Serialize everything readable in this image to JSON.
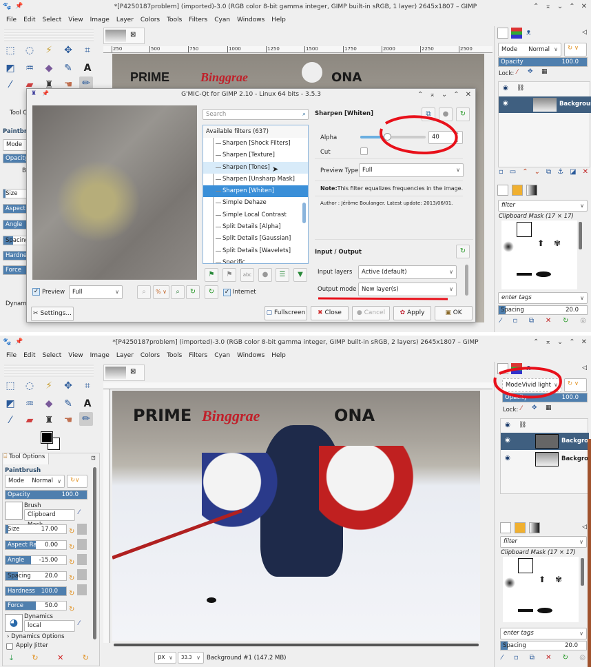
{
  "top": {
    "title": "*[P4250187problem] (imported)-3.0 (RGB color 8-bit gamma integer, GIMP built-in sRGB, 1 layer) 2645x1807 – GIMP",
    "window_controls": [
      "⌃",
      "⌅",
      "⌄",
      "⌃",
      "✕"
    ],
    "menu": [
      "File",
      "Edit",
      "Select",
      "View",
      "Image",
      "Layer",
      "Colors",
      "Tools",
      "Filters",
      "Cyan",
      "Windows",
      "Help"
    ],
    "ruler_ticks": [
      "250",
      "500",
      "750",
      "1000",
      "1250",
      "1500",
      "1750",
      "2000",
      "2250",
      "2500"
    ],
    "tool_options": {
      "tab": "Tool Op",
      "tool": "Paintbrush",
      "mode": "Mode",
      "opacity": "Opacity",
      "brush": "Br",
      "size": "Size",
      "aspect": "Aspect Ra",
      "angle": "Angle",
      "spacing": "Spacing",
      "hardness": "Hardness",
      "force": "Force",
      "dynamics": "Dynam"
    },
    "dock": {
      "mode_label": "Mode",
      "mode_value": "Normal",
      "opacity_label": "Opacity",
      "opacity_value": "100.0",
      "lock_label": "Lock:",
      "layers": [
        {
          "name": "Background"
        }
      ],
      "brush_filter": "filter",
      "brush_name": "Clipboard Mask (17 × 17)",
      "tags_placeholder": "enter tags",
      "spacing_label": "Spacing",
      "spacing_value": "20.0"
    },
    "photo_signage": [
      "PRIME",
      "Binggrae",
      "ONA"
    ]
  },
  "gmic": {
    "title": "G'MIC-Qt for GIMP 2.10 - Linux 64 bits - 3.5.3",
    "window_controls": [
      "⌃",
      "⌅",
      "⌄",
      "⌃",
      "✕"
    ],
    "search_placeholder": "Search",
    "filters_header": "Available filters (637)",
    "filters": [
      "Sharpen [Shock Filters]",
      "Sharpen [Texture]",
      "Sharpen [Tones]",
      "Sharpen [Unsharp Mask]",
      "Sharpen [Whiten]",
      "Simple Dehaze",
      "Simple Local Contrast",
      "Split Details [Alpha]",
      "Split Details [Gaussian]",
      "Split Details [Wavelets]",
      "Specific"
    ],
    "selected_filter": "Sharpen [Whiten]",
    "filter_title": "Sharpen [Whiten]",
    "alpha_label": "Alpha",
    "alpha_value": "40",
    "alpha_fraction": 0.4,
    "cut_label": "Cut",
    "preview_type_label": "Preview Type",
    "preview_type_value": "Full",
    "note_bold": "Note:",
    "note_text": "This filter equalizes frequencies in the image.",
    "author": "Author : Jérôme Boulanger. Latest update: 2013/06/01.",
    "io_title": "Input / Output",
    "input_layers_label": "Input layers",
    "input_layers_value": "Active (default)",
    "output_mode_label": "Output mode",
    "output_mode_value": "New layer(s)",
    "internet_label": "Internet",
    "preview_label": "Preview",
    "preview_value": "Full",
    "zoom_value": "%",
    "buttons": {
      "settings": "Settings...",
      "fullscreen": "Fullscreen",
      "close": "Close",
      "cancel": "Cancel",
      "apply": "Apply",
      "ok": "OK"
    }
  },
  "bottom": {
    "title": "*[P4250187problem] (imported)-3.0 (RGB color 8-bit gamma integer, GIMP built-in sRGB, 2 layers) 2645x1807 – GIMP",
    "window_controls": [
      "⌃",
      "⌅",
      "⌄",
      "⌃",
      "✕"
    ],
    "menu": [
      "File",
      "Edit",
      "Select",
      "View",
      "Image",
      "Layer",
      "Colors",
      "Tools",
      "Filters",
      "Cyan",
      "Windows",
      "Help"
    ],
    "tool_options": {
      "tab": "Tool Options",
      "tool": "Paintbrush",
      "mode_label": "Mode",
      "mode_value": "Normal",
      "opacity_label": "Opacity",
      "opacity_value": "100.0",
      "brush_label": "Brush",
      "brush_value": "Clipboard Mask",
      "size_label": "Size",
      "size_value": "17.00",
      "aspect_label": "Aspect Ratio",
      "aspect_value": "0.00",
      "angle_label": "Angle",
      "angle_value": "-15.00",
      "spacing_label": "Spacing",
      "spacing_value": "20.0",
      "hardness_label": "Hardness",
      "hardness_value": "100.0",
      "force_label": "Force",
      "force_value": "50.0",
      "dynamics_label": "Dynamics",
      "dynamics_value": "local",
      "dynamics_options": "Dynamics Options",
      "apply_jitter": "Apply Jitter"
    },
    "status": {
      "unit": "px",
      "zoom": "33.3",
      "layer_info": "Background #1 (147.2 MB)"
    },
    "dock": {
      "mode_label": "Mode",
      "mode_value": "Vivid light",
      "opacity_label": "Opacity",
      "opacity_value": "100.0",
      "lock_label": "Lock:",
      "layers": [
        {
          "name": "Background"
        },
        {
          "name": "Background"
        }
      ],
      "brush_filter": "filter",
      "brush_name": "Clipboard Mask (17 × 17)",
      "tags_placeholder": "enter tags",
      "spacing_label": "Spacing",
      "spacing_value": "20.0"
    },
    "photo_signage": [
      "PRIME",
      "Binggrae",
      "ONA"
    ]
  },
  "colors": {
    "accent": "#3a8fd8",
    "slider": "#4f7fae",
    "annotation": "#e8101a",
    "selected_layer": "#3f5f80"
  }
}
